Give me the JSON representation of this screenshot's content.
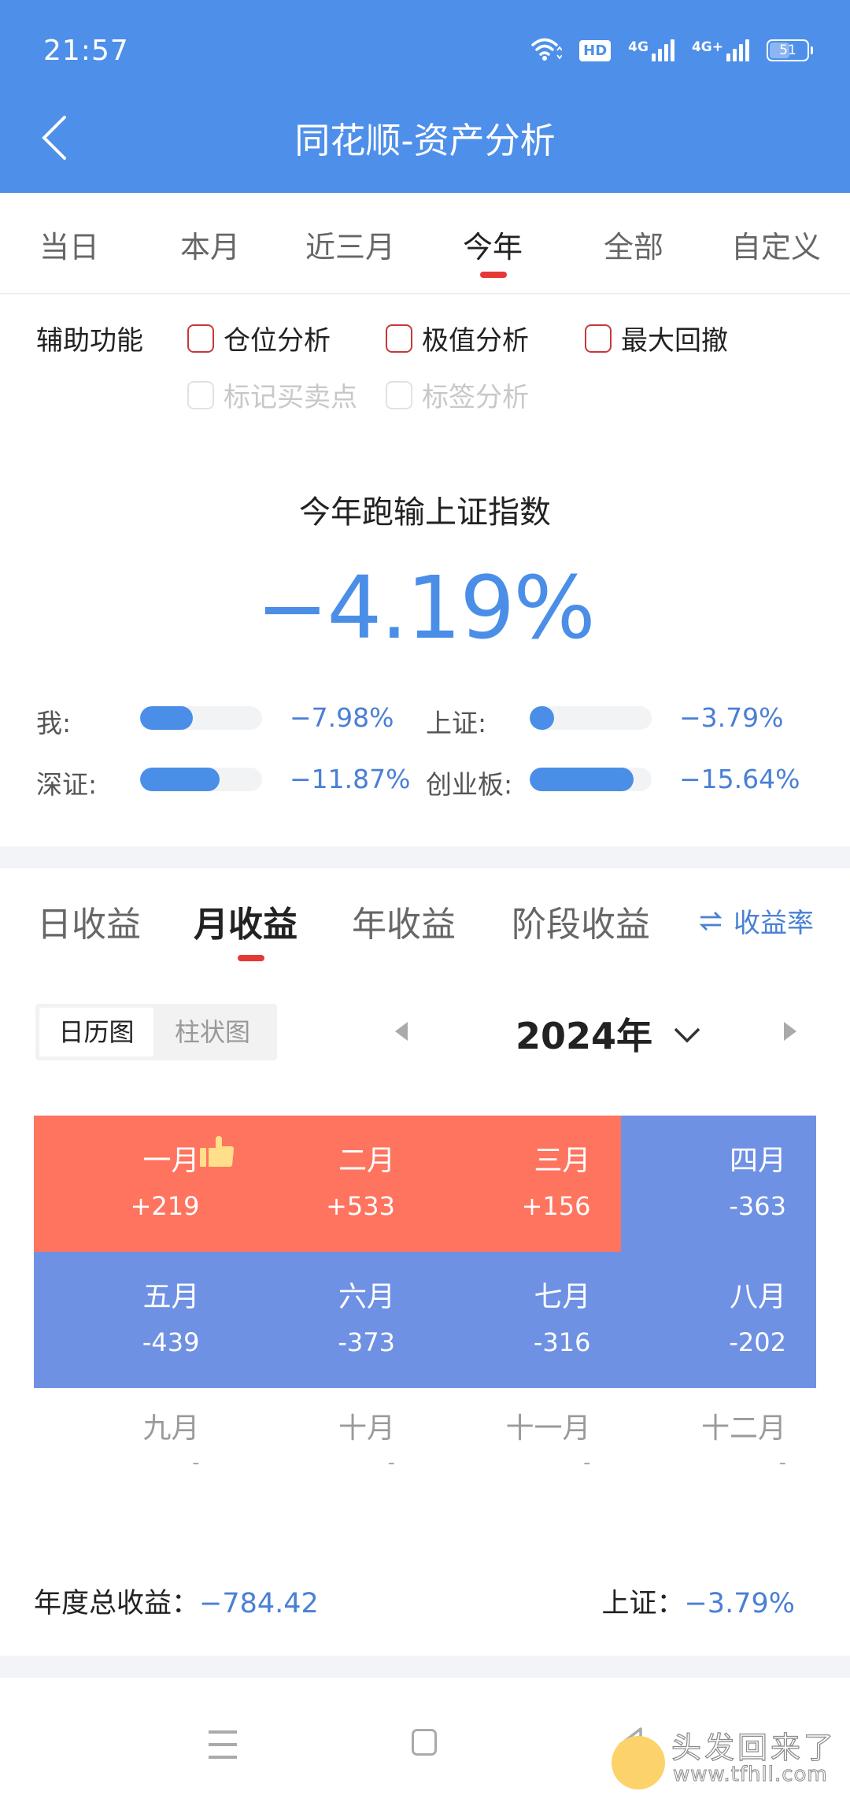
{
  "status_bar": {
    "time": "21:57",
    "icons": [
      "wifi-icon",
      "hd-voice-icon",
      "4g-signal-icon",
      "4g-plus-signal-icon",
      "battery-icon"
    ],
    "hd_label": "HD",
    "sim1_label": "4G",
    "sim2_label": "4G+",
    "battery_level": "51"
  },
  "header": {
    "title": "同花顺-资产分析",
    "back_icon": "chevron-left-icon"
  },
  "period_tabs": {
    "items": [
      {
        "label": "当日"
      },
      {
        "label": "本月"
      },
      {
        "label": "近三月"
      },
      {
        "label": "今年"
      },
      {
        "label": "全部"
      },
      {
        "label": "自定义"
      }
    ],
    "selected": "今年"
  },
  "assist": {
    "label": "辅助功能",
    "options": [
      {
        "label": "仓位分析",
        "checked": false,
        "enabled": true
      },
      {
        "label": "极值分析",
        "checked": false,
        "enabled": true
      },
      {
        "label": "最大回撤",
        "checked": false,
        "enabled": true
      },
      {
        "label": "标记买卖点",
        "checked": false,
        "enabled": false
      },
      {
        "label": "标签分析",
        "checked": false,
        "enabled": false
      }
    ]
  },
  "summary": {
    "title": "今年跑输上证指数",
    "value": "−4.19%",
    "comparisons": [
      {
        "label": "我:",
        "value": "−7.98%",
        "bar_fraction": 0.43
      },
      {
        "label": "上证:",
        "value": "−3.79%",
        "bar_fraction": 0.2
      },
      {
        "label": "深证:",
        "value": "−11.87%",
        "bar_fraction": 0.65
      },
      {
        "label": "创业板:",
        "value": "−15.64%",
        "bar_fraction": 0.85
      }
    ]
  },
  "earnings_tabs": {
    "items": [
      {
        "label": "日收益"
      },
      {
        "label": "月收益"
      },
      {
        "label": "年收益"
      },
      {
        "label": "阶段收益"
      }
    ],
    "selected": "月收益",
    "switch_label": "收益率",
    "switch_icon": "swap-arrows-icon"
  },
  "view_toggle": {
    "options": [
      "日历图",
      "柱状图"
    ],
    "selected": "日历图"
  },
  "year_selector": {
    "value": "2024年",
    "prev_icon": "triangle-left-icon",
    "next_icon": "triangle-right-icon",
    "dropdown_icon": "chevron-down-icon"
  },
  "calendar": {
    "colors": {
      "gain": "#ff745f",
      "loss": "#6f91e4"
    },
    "best_month_badge": "thumbs-up-icon",
    "months": [
      {
        "label": "一月",
        "value": "+219",
        "state": "gain"
      },
      {
        "label": "二月",
        "value": "+533",
        "state": "gain",
        "best": true
      },
      {
        "label": "三月",
        "value": "+156",
        "state": "gain"
      },
      {
        "label": "四月",
        "value": "-363",
        "state": "loss"
      },
      {
        "label": "五月",
        "value": "-439",
        "state": "loss"
      },
      {
        "label": "六月",
        "value": "-373",
        "state": "loss"
      },
      {
        "label": "七月",
        "value": "-316",
        "state": "loss"
      },
      {
        "label": "八月",
        "value": "-202",
        "state": "loss"
      },
      {
        "label": "九月",
        "value": "-",
        "state": "empty"
      },
      {
        "label": "十月",
        "value": "-",
        "state": "empty"
      },
      {
        "label": "十一月",
        "value": "-",
        "state": "empty"
      },
      {
        "label": "十二月",
        "value": "-",
        "state": "empty"
      }
    ]
  },
  "totals": {
    "annual_label": "年度总收益：",
    "annual_value": "−784.42",
    "index_label": "上证：",
    "index_value": "−3.79%"
  },
  "nav_bar": {
    "icons": [
      "menu-icon",
      "home-icon",
      "back-icon"
    ]
  },
  "watermark": {
    "text": "头发回来了",
    "url": "www.tfhll.com"
  },
  "colors": {
    "header_blue": "#4e8fea",
    "accent_blue": "#4a8ee8",
    "underline_red": "#e53935",
    "checkbox_red": "#c8383a"
  }
}
